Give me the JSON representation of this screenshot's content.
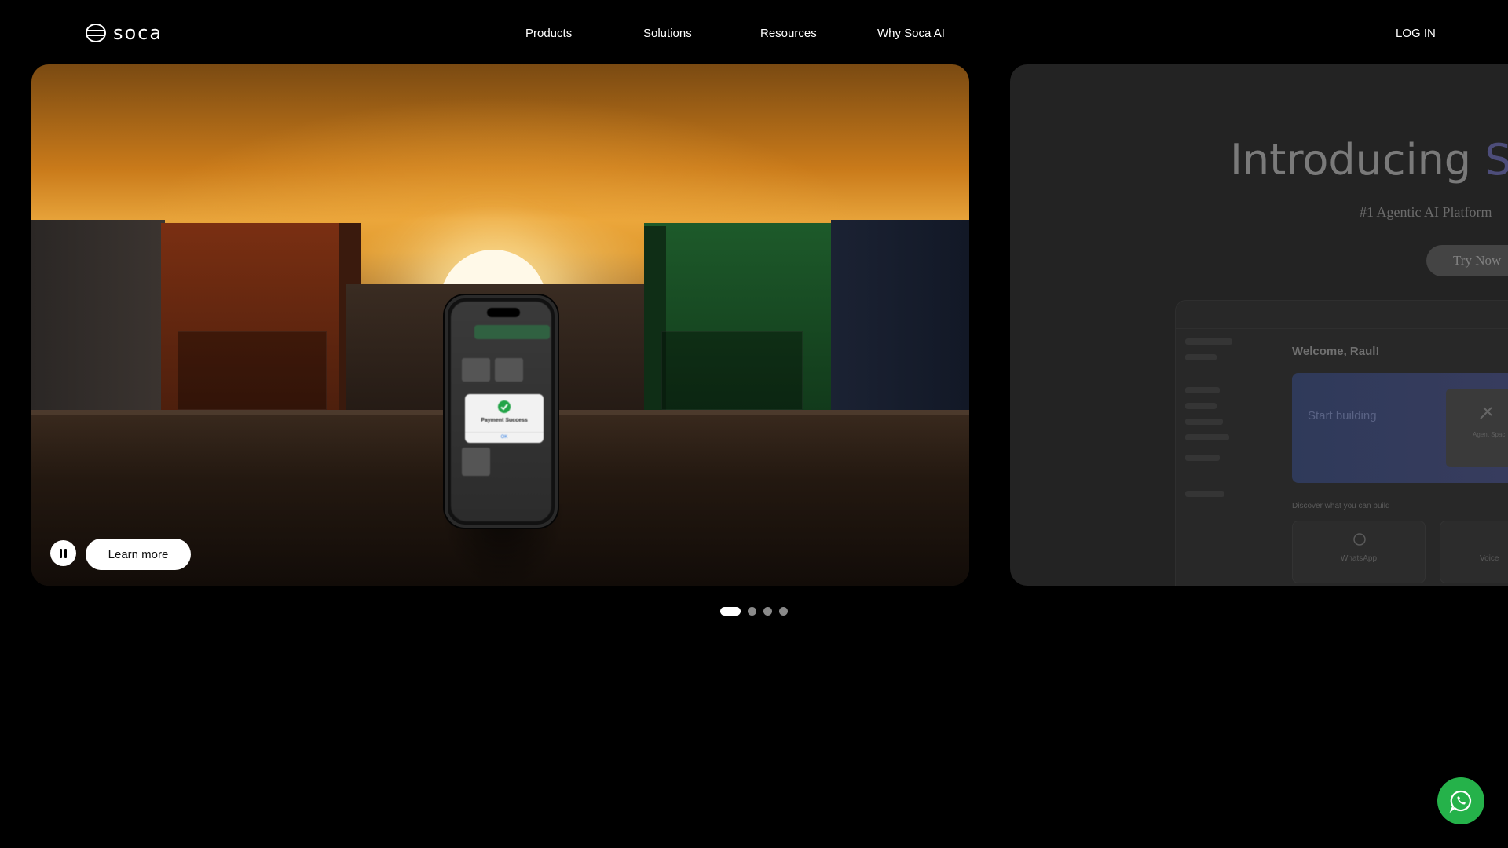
{
  "brand": {
    "name": "soca",
    "logo_icon": "soca-logo-icon"
  },
  "nav": {
    "items": [
      {
        "label": "Products"
      },
      {
        "label": "Solutions"
      },
      {
        "label": "Resources"
      },
      {
        "label": "Why Soca AI"
      }
    ],
    "login_label": "LOG IN"
  },
  "hero": {
    "slide_1": {
      "phone_popup": {
        "title": "Payment Success",
        "ok_label": "OK"
      },
      "pause_icon": "pause-icon",
      "learn_more_label": "Learn more"
    },
    "slide_2": {
      "title_main": "Introducing ",
      "title_accent": "So",
      "subtitle": "#1 Agentic AI Platform",
      "cta_label": "Try Now",
      "dashboard": {
        "welcome": "Welcome, Raul!",
        "start_card_title": "Start building",
        "agent_card_label": "Agent Spac",
        "discover_label": "Discover what you can build",
        "whatsapp_label": "WhatsApp",
        "voice_label": "Voice"
      }
    }
  },
  "pagination": {
    "count": 4,
    "active_index": 0
  },
  "floating": {
    "whatsapp_icon": "whatsapp-icon",
    "color": "#25b24a"
  },
  "colors": {
    "background": "#000000",
    "accent_green": "#25b24a"
  }
}
